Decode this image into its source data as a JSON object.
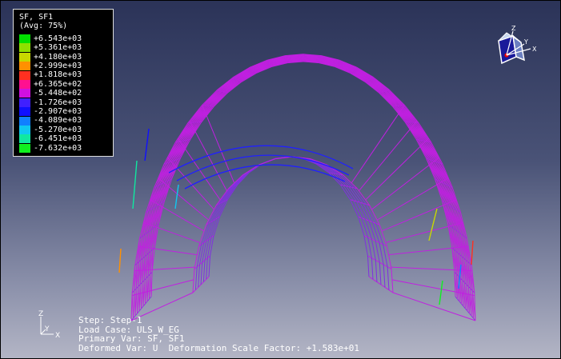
{
  "legend": {
    "title": "SF, SF1",
    "subtitle": "(Avg: 75%)",
    "entries": [
      {
        "value": "+6.543e+03",
        "color": "#00e000"
      },
      {
        "value": "+5.361e+03",
        "color": "#8ee000"
      },
      {
        "value": "+4.180e+03",
        "color": "#c8d800"
      },
      {
        "value": "+2.999e+03",
        "color": "#ff9000"
      },
      {
        "value": "+1.818e+03",
        "color": "#ff3020"
      },
      {
        "value": "+6.365e+02",
        "color": "#ff1090"
      },
      {
        "value": "-5.448e+02",
        "color": "#d010e0"
      },
      {
        "value": "-1.726e+03",
        "color": "#4020ff"
      },
      {
        "value": "-2.907e+03",
        "color": "#1010ff"
      },
      {
        "value": "-4.089e+03",
        "color": "#1080ff"
      },
      {
        "value": "-5.270e+03",
        "color": "#10c8f0"
      },
      {
        "value": "-6.451e+03",
        "color": "#10e8a0"
      },
      {
        "value": "-7.632e+03",
        "color": "#10f020"
      }
    ]
  },
  "info": {
    "step": "Step: Step-1",
    "load_case": "Load Case: ULS_W_EG",
    "primary_var": "Primary Var: SF, SF1",
    "deformed_var": "Deformed Var: U  Deformation Scale Factor: +1.583e+01"
  },
  "triad": {
    "x": "X",
    "y": "Y",
    "z": "Z"
  },
  "axis2d": {
    "x": "X",
    "y": "Y",
    "z": "Z"
  },
  "colors": {
    "mesh_primary": "#c020e0",
    "mesh_secondary": "#8030e0",
    "mesh_blue": "#2020ff"
  }
}
